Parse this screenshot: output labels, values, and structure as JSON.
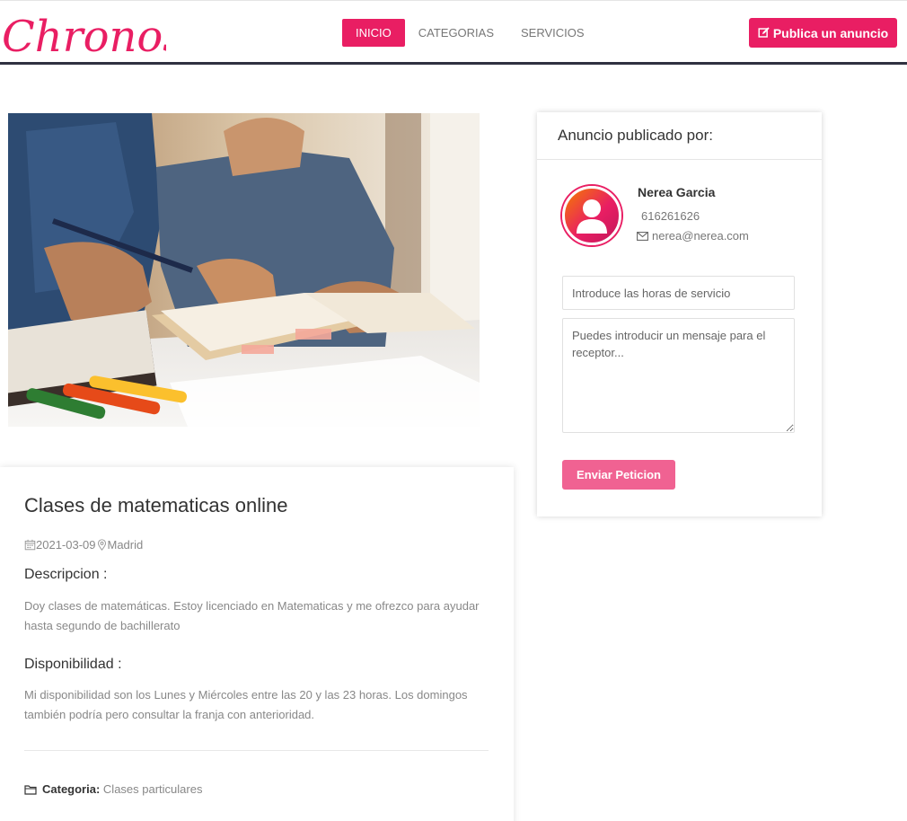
{
  "brand": {
    "logo_text": "Chronos",
    "accent": "#e91e63"
  },
  "nav": {
    "items": [
      {
        "label": "INICIO",
        "active": true
      },
      {
        "label": "CATEGORIAS",
        "active": false
      },
      {
        "label": "SERVICIOS",
        "active": false
      }
    ],
    "publish_label": "Publica un anuncio",
    "publish_icon": "edit-icon"
  },
  "listing": {
    "title": "Clases de matematicas online",
    "date": "2021-03-09",
    "location": "Madrid",
    "description_heading": "Descripcion :",
    "description": "Doy clases de matemáticas. Estoy licenciado en Matematicas y me ofrezco para ayudar hasta segundo de bachillerato",
    "availability_heading": "Disponibilidad :",
    "availability": "Mi disponibilidad son los Lunes y Miércoles entre las 20 y las 23 horas. Los domingos también podría pero consultar la franja con anterioridad.",
    "category_label": "Categoria:",
    "category_value": "Clases particulares"
  },
  "publisher": {
    "heading": "Anuncio publicado por:",
    "name": "Nerea Garcia",
    "phone": "616261626",
    "email": "nerea@nerea.com"
  },
  "request_form": {
    "hours_placeholder": "Introduce las horas de servicio",
    "message_placeholder": "Puedes introducir un mensaje para el receptor...",
    "submit_label": "Enviar Peticion"
  }
}
